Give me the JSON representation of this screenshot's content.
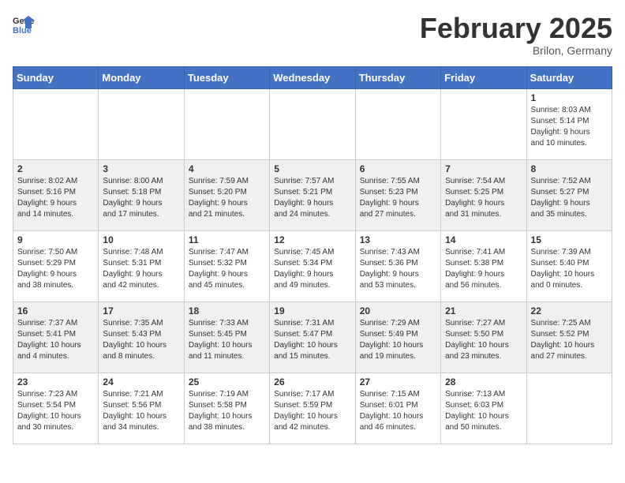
{
  "logo": {
    "general": "General",
    "blue": "Blue"
  },
  "title": "February 2025",
  "subtitle": "Brilon, Germany",
  "days_header": [
    "Sunday",
    "Monday",
    "Tuesday",
    "Wednesday",
    "Thursday",
    "Friday",
    "Saturday"
  ],
  "weeks": [
    [
      {
        "num": "",
        "info": ""
      },
      {
        "num": "",
        "info": ""
      },
      {
        "num": "",
        "info": ""
      },
      {
        "num": "",
        "info": ""
      },
      {
        "num": "",
        "info": ""
      },
      {
        "num": "",
        "info": ""
      },
      {
        "num": "1",
        "info": "Sunrise: 8:03 AM\nSunset: 5:14 PM\nDaylight: 9 hours\nand 10 minutes."
      }
    ],
    [
      {
        "num": "2",
        "info": "Sunrise: 8:02 AM\nSunset: 5:16 PM\nDaylight: 9 hours\nand 14 minutes."
      },
      {
        "num": "3",
        "info": "Sunrise: 8:00 AM\nSunset: 5:18 PM\nDaylight: 9 hours\nand 17 minutes."
      },
      {
        "num": "4",
        "info": "Sunrise: 7:59 AM\nSunset: 5:20 PM\nDaylight: 9 hours\nand 21 minutes."
      },
      {
        "num": "5",
        "info": "Sunrise: 7:57 AM\nSunset: 5:21 PM\nDaylight: 9 hours\nand 24 minutes."
      },
      {
        "num": "6",
        "info": "Sunrise: 7:55 AM\nSunset: 5:23 PM\nDaylight: 9 hours\nand 27 minutes."
      },
      {
        "num": "7",
        "info": "Sunrise: 7:54 AM\nSunset: 5:25 PM\nDaylight: 9 hours\nand 31 minutes."
      },
      {
        "num": "8",
        "info": "Sunrise: 7:52 AM\nSunset: 5:27 PM\nDaylight: 9 hours\nand 35 minutes."
      }
    ],
    [
      {
        "num": "9",
        "info": "Sunrise: 7:50 AM\nSunset: 5:29 PM\nDaylight: 9 hours\nand 38 minutes."
      },
      {
        "num": "10",
        "info": "Sunrise: 7:48 AM\nSunset: 5:31 PM\nDaylight: 9 hours\nand 42 minutes."
      },
      {
        "num": "11",
        "info": "Sunrise: 7:47 AM\nSunset: 5:32 PM\nDaylight: 9 hours\nand 45 minutes."
      },
      {
        "num": "12",
        "info": "Sunrise: 7:45 AM\nSunset: 5:34 PM\nDaylight: 9 hours\nand 49 minutes."
      },
      {
        "num": "13",
        "info": "Sunrise: 7:43 AM\nSunset: 5:36 PM\nDaylight: 9 hours\nand 53 minutes."
      },
      {
        "num": "14",
        "info": "Sunrise: 7:41 AM\nSunset: 5:38 PM\nDaylight: 9 hours\nand 56 minutes."
      },
      {
        "num": "15",
        "info": "Sunrise: 7:39 AM\nSunset: 5:40 PM\nDaylight: 10 hours\nand 0 minutes."
      }
    ],
    [
      {
        "num": "16",
        "info": "Sunrise: 7:37 AM\nSunset: 5:41 PM\nDaylight: 10 hours\nand 4 minutes."
      },
      {
        "num": "17",
        "info": "Sunrise: 7:35 AM\nSunset: 5:43 PM\nDaylight: 10 hours\nand 8 minutes."
      },
      {
        "num": "18",
        "info": "Sunrise: 7:33 AM\nSunset: 5:45 PM\nDaylight: 10 hours\nand 11 minutes."
      },
      {
        "num": "19",
        "info": "Sunrise: 7:31 AM\nSunset: 5:47 PM\nDaylight: 10 hours\nand 15 minutes."
      },
      {
        "num": "20",
        "info": "Sunrise: 7:29 AM\nSunset: 5:49 PM\nDaylight: 10 hours\nand 19 minutes."
      },
      {
        "num": "21",
        "info": "Sunrise: 7:27 AM\nSunset: 5:50 PM\nDaylight: 10 hours\nand 23 minutes."
      },
      {
        "num": "22",
        "info": "Sunrise: 7:25 AM\nSunset: 5:52 PM\nDaylight: 10 hours\nand 27 minutes."
      }
    ],
    [
      {
        "num": "23",
        "info": "Sunrise: 7:23 AM\nSunset: 5:54 PM\nDaylight: 10 hours\nand 30 minutes."
      },
      {
        "num": "24",
        "info": "Sunrise: 7:21 AM\nSunset: 5:56 PM\nDaylight: 10 hours\nand 34 minutes."
      },
      {
        "num": "25",
        "info": "Sunrise: 7:19 AM\nSunset: 5:58 PM\nDaylight: 10 hours\nand 38 minutes."
      },
      {
        "num": "26",
        "info": "Sunrise: 7:17 AM\nSunset: 5:59 PM\nDaylight: 10 hours\nand 42 minutes."
      },
      {
        "num": "27",
        "info": "Sunrise: 7:15 AM\nSunset: 6:01 PM\nDaylight: 10 hours\nand 46 minutes."
      },
      {
        "num": "28",
        "info": "Sunrise: 7:13 AM\nSunset: 6:03 PM\nDaylight: 10 hours\nand 50 minutes."
      },
      {
        "num": "",
        "info": ""
      }
    ]
  ]
}
